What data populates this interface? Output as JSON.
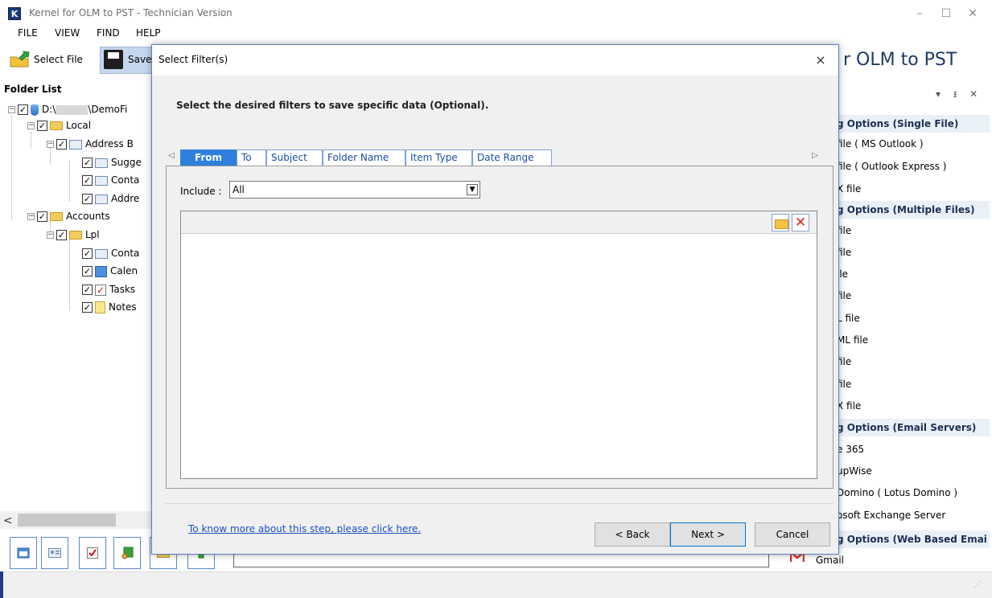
{
  "window": {
    "title": "Kernel for OLM to PST - Technician Version",
    "icon_letter": "K",
    "minimize": "–",
    "maximize": "☐",
    "close": "✕",
    "product_title": "r OLM to PST"
  },
  "menu": [
    "FILE",
    "VIEW",
    "FIND",
    "HELP"
  ],
  "toolbar": {
    "select_file": "Select File",
    "save": "Save"
  },
  "folder_panel": {
    "title": "Folder List",
    "nodes": {
      "root": "D:\\",
      "root_suffix": "\\DemoFi",
      "local": "Local",
      "address_book": "Address B",
      "suggested": "Sugge",
      "contacts1": "Conta",
      "address": "Addre",
      "accounts": "Accounts",
      "lpl": "Lpl",
      "contacts2": "Conta",
      "calendar": "Calen",
      "tasks": "Tasks",
      "notes": "Notes"
    },
    "scroll_left": "<"
  },
  "right_panel": {
    "controls": "▾ ᵻ ✕",
    "header_single": "g Options (Single File)",
    "single_items": [
      "file ( MS Outlook )",
      "file ( Outlook Express )",
      "X file"
    ],
    "header_multiple": "g Options (Multiple Files)",
    "multiple_items": [
      "file",
      "file",
      "ile",
      "file",
      "L file",
      "ML file",
      "file",
      "file",
      "X file"
    ],
    "header_email": "g Options (Email Servers)",
    "email_items": [
      "e 365",
      "upWise",
      "Domino ( Lotus Domino )",
      "osoft Exchange Server"
    ],
    "header_web": "g Options (Web Based Emai",
    "web_items": [
      "Gmail"
    ]
  },
  "dialog": {
    "title": "Select Filter(s)",
    "close": "×",
    "instruction": "Select the desired filters to save specific data (Optional).",
    "tab_prev": "◁",
    "tab_next": "▷",
    "tabs": [
      "From",
      "To",
      "Subject",
      "Folder Name",
      "Item Type",
      "Date Range"
    ],
    "active_tab": "From",
    "include_label": "Include :",
    "include_value": "All",
    "select_arrow": "▼",
    "remove_icon": "✕",
    "help_link": "To know more about this step, please click here.",
    "back": "< Back",
    "next": "Next >",
    "cancel": "Cancel"
  },
  "colors": {
    "accent": "#2f7fdc",
    "link": "#1a4fc7",
    "dialog_border": "#5a80b8",
    "product_title": "#1f3b63"
  }
}
